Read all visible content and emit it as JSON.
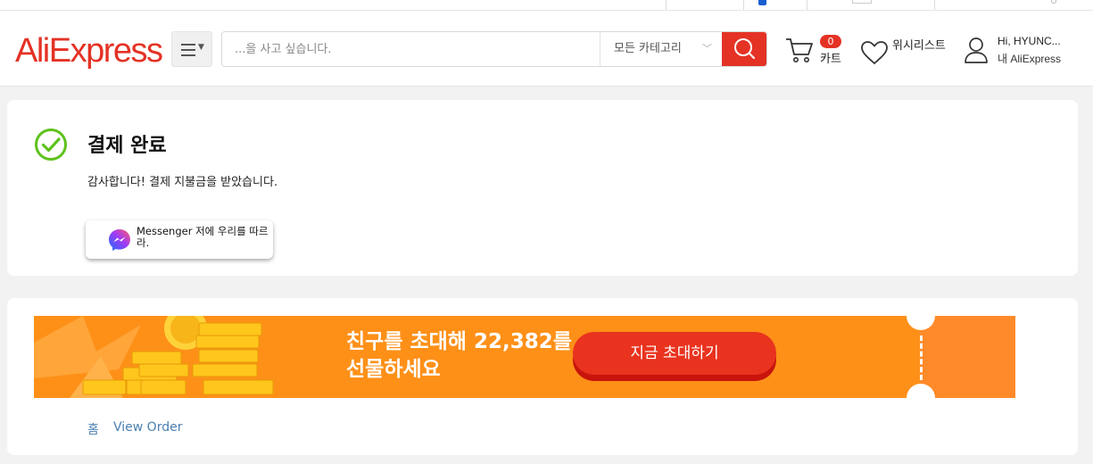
{
  "header": {
    "logo": "AliExpress",
    "search_placeholder": "...을 사고 싶습니다.",
    "category": "모든 카테고리",
    "cart_count": "0",
    "cart_label": "카트",
    "wishlist_label": "위시리스트",
    "user_greeting": "Hi, HYUNC...",
    "user_account": "내 AliExpress"
  },
  "payment": {
    "title": "결제 완료",
    "message": "감사합니다! 결제 지불금을 받았습니다.",
    "messenger_button": "Messenger 저에 우리를 따르라."
  },
  "banner": {
    "text": "친구를 초대해 22,382를 선물하세요",
    "button": "지금 초대하기"
  },
  "breadcrumb": {
    "home": "홈",
    "view_order": "View Order"
  },
  "colors": {
    "brand": "#e43225",
    "success": "#5ec21b",
    "banner": "#fe9018",
    "link": "#4a7fb0"
  }
}
